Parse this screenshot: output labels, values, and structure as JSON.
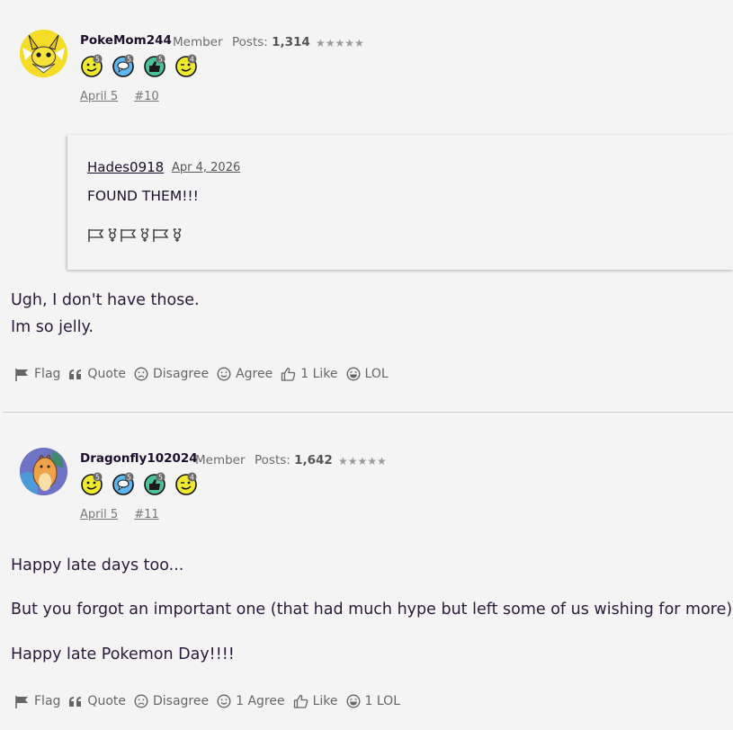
{
  "posts": [
    {
      "author": "PokeMom244",
      "role": "Member",
      "posts_label": "Posts:",
      "posts_count": "1,314",
      "stars": "★★★★★",
      "badges": [
        {
          "icon": "smiley-badge-icon",
          "count": "5",
          "color": "#f0ea2f"
        },
        {
          "icon": "speech-bubble-badge-icon",
          "count": "5",
          "color": "#5db7ef"
        },
        {
          "icon": "thumbs-up-badge-icon",
          "count": "5",
          "color": "#49c29a"
        },
        {
          "icon": "wink-badge-icon",
          "count": "4",
          "color": "#f0ea2f"
        }
      ],
      "date": "April 5",
      "number": "#10",
      "quote": {
        "author": "Hades0918",
        "date": "Apr 4, 2026",
        "text": "FOUND THEM!!!",
        "emoji": [
          "🏳",
          "⚧",
          "🏳",
          "⚧",
          "🏳",
          "⚧"
        ]
      },
      "lines": [
        "Ugh, I don't have those.",
        "Im so jelly."
      ],
      "actions": {
        "flag": "Flag",
        "quote": "Quote",
        "disagree": "Disagree",
        "agree": "Agree",
        "like": "1 Like",
        "lol": "LOL"
      }
    },
    {
      "author": "Dragonfly102024",
      "role": "Member",
      "posts_label": "Posts:",
      "posts_count": "1,642",
      "stars": "★★★★★",
      "badges": [
        {
          "icon": "smiley-badge-icon",
          "count": "5",
          "color": "#f0ea2f"
        },
        {
          "icon": "speech-bubble-badge-icon",
          "count": "5",
          "color": "#5db7ef"
        },
        {
          "icon": "thumbs-up-badge-icon",
          "count": "5",
          "color": "#49c29a"
        },
        {
          "icon": "wink-badge-icon",
          "count": "4",
          "color": "#f0ea2f"
        }
      ],
      "date": "April 5",
      "number": "#11",
      "lines": [
        "Happy late days too...",
        "But you forgot an important one (that had much hype but left some of us wishing for more)",
        "Happy late Pokemon Day!!!!"
      ],
      "actions": {
        "flag": "Flag",
        "quote": "Quote",
        "disagree": "Disagree",
        "agree": "1 Agree",
        "like": "Like",
        "lol": "1 LOL"
      }
    }
  ]
}
